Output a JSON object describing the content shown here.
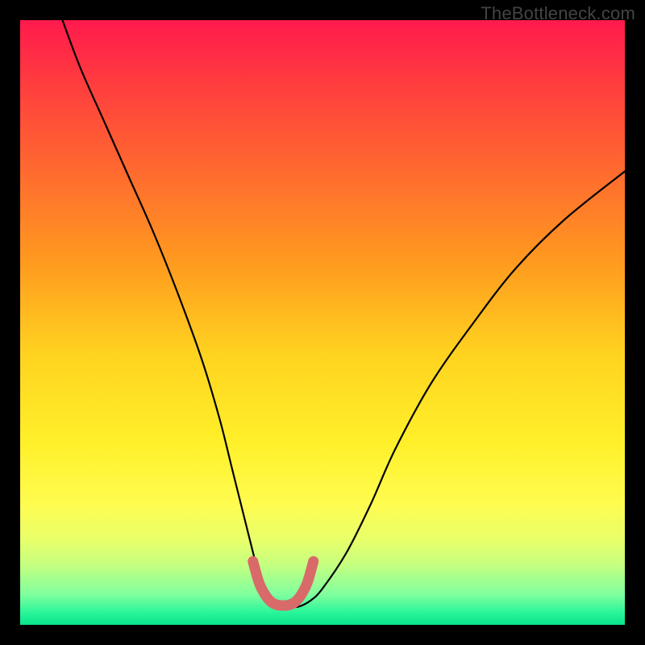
{
  "watermark": "TheBottleneck.com",
  "chart_data": {
    "type": "line",
    "title": "",
    "xlabel": "",
    "ylabel": "",
    "xlim": [
      0,
      100
    ],
    "ylim": [
      0,
      100
    ],
    "series": [
      {
        "name": "bottleneck-curve",
        "x": [
          7,
          10,
          14,
          18,
          22,
          26,
          30,
          33,
          35,
          37,
          39,
          40,
          41,
          42,
          44,
          46,
          48,
          50,
          54,
          58,
          62,
          68,
          75,
          82,
          90,
          100
        ],
        "values": [
          100,
          92,
          83,
          74,
          65,
          55,
          44,
          34,
          26,
          18,
          10,
          6,
          4,
          3,
          3,
          3,
          4,
          6,
          12,
          20,
          29,
          40,
          50,
          59,
          67,
          75
        ]
      },
      {
        "name": "optimal-zone-marker",
        "x": [
          38.5,
          39.5,
          40.5,
          41.5,
          42.5,
          43.5,
          44.5,
          45.5,
          46.5,
          47.5,
          48.5
        ],
        "values": [
          10.5,
          7.0,
          5.0,
          3.8,
          3.3,
          3.2,
          3.3,
          3.8,
          5.0,
          7.0,
          10.5
        ]
      }
    ],
    "marker_color": "#d86a6a",
    "curve_color": "#000000"
  }
}
